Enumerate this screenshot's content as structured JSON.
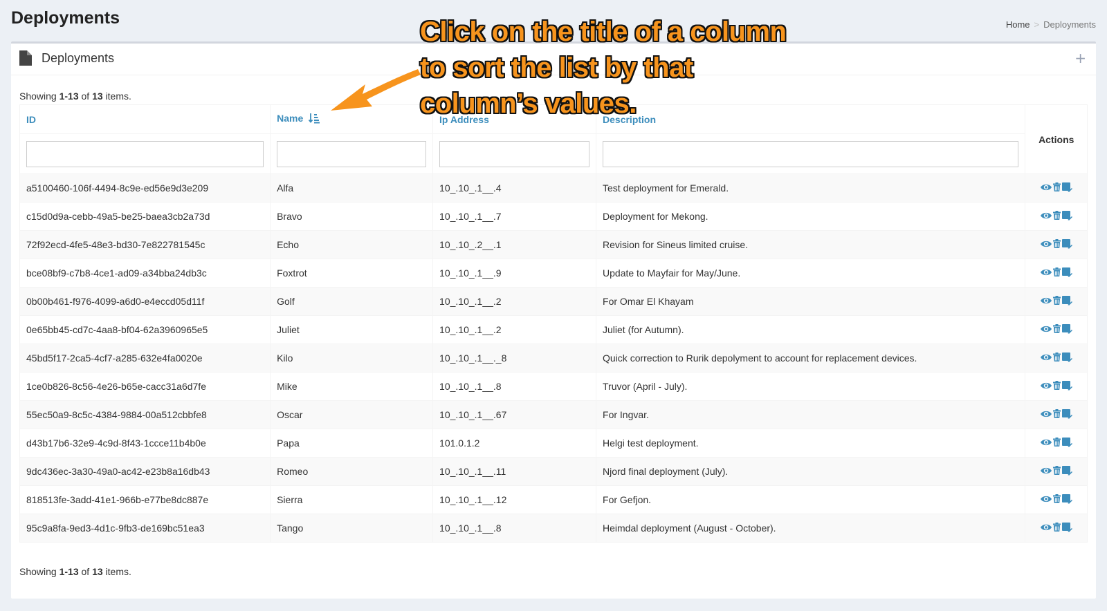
{
  "page": {
    "title": "Deployments"
  },
  "breadcrumb": {
    "home": "Home",
    "separator": ">",
    "current": "Deployments"
  },
  "box": {
    "title": "Deployments",
    "icon": "file-icon",
    "expand": "+"
  },
  "summary": {
    "prefix": "Showing ",
    "range": "1-13",
    "middle": " of ",
    "total": "13",
    "suffix": " items."
  },
  "table": {
    "columns": {
      "id": "ID",
      "name": "Name",
      "ip": "Ip Address",
      "description": "Description",
      "actions": "Actions"
    },
    "sort_icon": "sort-alpha-asc-icon",
    "rows": [
      {
        "id": "a5100460-106f-4494-8c9e-ed56e9d3e209",
        "name": "Alfa",
        "ip": "10_.10_.1__.4",
        "description": "Test deployment for Emerald."
      },
      {
        "id": "c15d0d9a-cebb-49a5-be25-baea3cb2a73d",
        "name": "Bravo",
        "ip": "10_.10_.1__.7",
        "description": "Deployment for Mekong."
      },
      {
        "id": "72f92ecd-4fe5-48e3-bd30-7e822781545c",
        "name": "Echo",
        "ip": "10_.10_.2__.1",
        "description": "Revision for Sineus limited cruise."
      },
      {
        "id": "bce08bf9-c7b8-4ce1-ad09-a34bba24db3c",
        "name": "Foxtrot",
        "ip": "10_.10_.1__.9",
        "description": "Update to Mayfair for May/June."
      },
      {
        "id": "0b00b461-f976-4099-a6d0-e4eccd05d11f",
        "name": "Golf",
        "ip": "10_.10_.1__.2",
        "description": "For Omar El Khayam"
      },
      {
        "id": "0e65bb45-cd7c-4aa8-bf04-62a3960965e5",
        "name": "Juliet",
        "ip": "10_.10_.1__.2",
        "description": "Juliet (for Autumn)."
      },
      {
        "id": "45bd5f17-2ca5-4cf7-a285-632e4fa0020e",
        "name": "Kilo",
        "ip": "10_.10_.1__._8",
        "description": "Quick correction to Rurik depolyment to account for replacement devices."
      },
      {
        "id": "1ce0b826-8c56-4e26-b65e-cacc31a6d7fe",
        "name": "Mike",
        "ip": "10_.10_.1__.8",
        "description": "Truvor (April - July)."
      },
      {
        "id": "55ec50a9-8c5c-4384-9884-00a512cbbfe8",
        "name": "Oscar",
        "ip": "10_.10_.1__.67",
        "description": "For Ingvar."
      },
      {
        "id": "d43b17b6-32e9-4c9d-8f43-1ccce11b4b0e",
        "name": "Papa",
        "ip": "101.0.1.2",
        "description": "Helgi test deployment."
      },
      {
        "id": "9dc436ec-3a30-49a0-ac42-e23b8a16db43",
        "name": "Romeo",
        "ip": "10_.10_.1__.11",
        "description": "Njord final deployment (July)."
      },
      {
        "id": "818513fe-3add-41e1-966b-e77be8dc887e",
        "name": "Sierra",
        "ip": "10_.10_.1__.12",
        "description": "For Gefjon."
      },
      {
        "id": "95c9a8fa-9ed3-4d1c-9fb3-de169bc51ea3",
        "name": "Tango",
        "ip": "10_.10_.1__.8",
        "description": "Heimdal deployment (August - October)."
      }
    ],
    "action_icons": [
      "eye-icon",
      "trash-icon",
      "edit-icon"
    ]
  },
  "annotation": {
    "text": "Click on the title of a column to sort the list by that column’s values."
  },
  "colors": {
    "link": "#3c8dbc",
    "callout": "#f7941d",
    "background": "#ecf0f5"
  }
}
